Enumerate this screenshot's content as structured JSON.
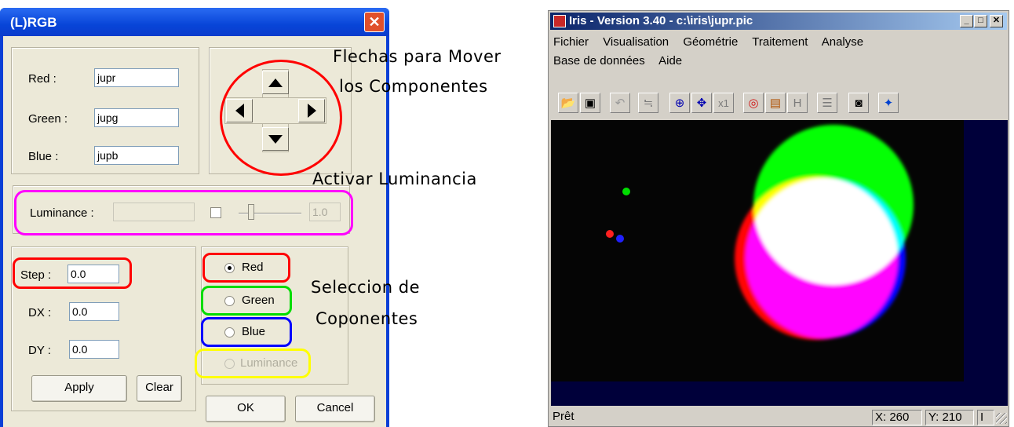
{
  "dialog": {
    "title": "(L)RGB",
    "close_glyph": "✕",
    "fields": {
      "red_label": "Red :",
      "red_value": "jupr",
      "green_label": "Green :",
      "green_value": "jupg",
      "blue_label": "Blue :",
      "blue_value": "jupb"
    },
    "luminance": {
      "label": "Luminance :",
      "value": "",
      "slider_value": "1.0"
    },
    "offsets": {
      "step_label": "Step :",
      "step_value": "0.0",
      "dx_label": "DX :",
      "dx_value": "0.0",
      "dy_label": "DY :",
      "dy_value": "0.0"
    },
    "buttons": {
      "apply": "Apply",
      "clear": "Clear",
      "ok": "OK",
      "cancel": "Cancel"
    },
    "components": [
      {
        "label": "Red",
        "checked": true,
        "enabled": true,
        "highlight": "#ff0000"
      },
      {
        "label": "Green",
        "checked": false,
        "enabled": true,
        "highlight": "#00dd00"
      },
      {
        "label": "Blue",
        "checked": false,
        "enabled": true,
        "highlight": "#0000ff"
      },
      {
        "label": "Luminance",
        "checked": false,
        "enabled": false,
        "highlight": "#ffff00"
      }
    ],
    "highlights": {
      "arrows": "#ff0000",
      "luminance": "#ff00ff",
      "step": "#ff0000"
    }
  },
  "annotations": {
    "arrows_line1": "Flechas para Mover",
    "arrows_line2": "los Componentes",
    "luminance": "Activar Luminancia",
    "selection_line1": "Seleccion de",
    "selection_line2": "Coponentes"
  },
  "iris": {
    "title": "Iris - Version 3.40 - c:\\iris\\jupr.pic",
    "window_buttons": [
      "_",
      "□",
      "✕"
    ],
    "menu_row1": [
      "Fichier",
      "Visualisation",
      "Géométrie",
      "Traitement",
      "Analyse"
    ],
    "menu_row2": [
      "Base de données",
      "Aide"
    ],
    "toolbar_icons": [
      "open-folder-icon",
      "save-icon",
      "undo-icon",
      "adjust-icon",
      "zoom-fit-icon",
      "move-icon",
      "x1-icon",
      "rgb-icon",
      "list-icon",
      "histogram-icon",
      "lines-icon",
      "camera-icon",
      "diamond-icon"
    ],
    "status": {
      "text": "Prêt",
      "x": "X: 260",
      "y": "Y: 210",
      "extra": "I"
    }
  }
}
